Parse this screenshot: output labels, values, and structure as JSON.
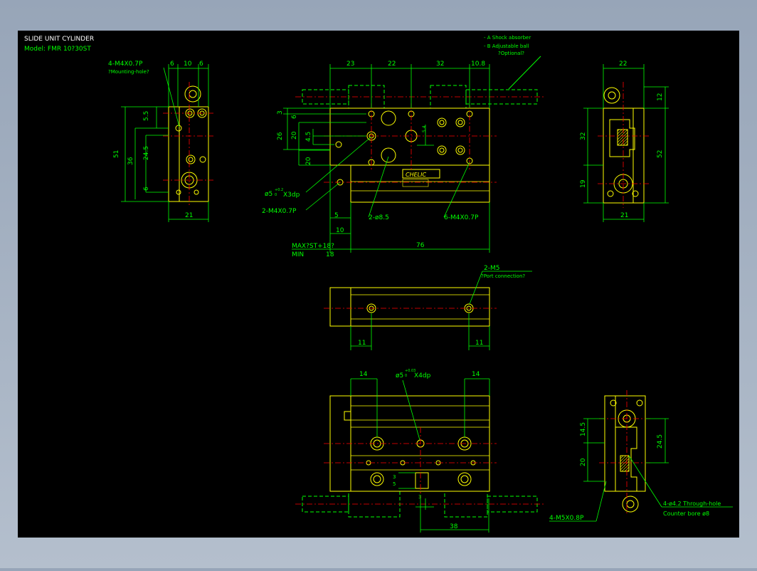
{
  "title_block": {
    "title": "SLIDE UNIT CYLINDER",
    "model": "Model: FMR 10?30ST"
  },
  "legend": {
    "item_a": "- A  Shock absorber",
    "item_b": "- B  Adjustable ball",
    "item_b_note": "?Optional?"
  },
  "colors": {
    "background": "#000000",
    "outline": "#ffff00",
    "dimension": "#00ff00",
    "centerline": "#ff0000",
    "hidden": "#00ff00"
  },
  "left_view": {
    "callout": "4-M4X0.7P",
    "callout_note": "?Mounting-hole?",
    "dim_top": [
      "6",
      "10",
      "6"
    ],
    "dim_left": [
      "5.5",
      "51",
      "36",
      "24.5",
      "6"
    ],
    "dim_bottom": "21"
  },
  "front_view": {
    "dim_top": [
      "23",
      "22",
      "32",
      "10.8"
    ],
    "dim_left": [
      "3",
      "6",
      "26",
      "20",
      "4.5",
      "20"
    ],
    "dim_inner": "5.4",
    "hole_callout": "ø5",
    "hole_tol": "+0.2",
    "hole_tol2": "0",
    "hole_depth": "X3dp",
    "callout_m4": "2-M4X0.7P",
    "callout_d85": "2-ø8.5",
    "callout_6m4": "6-M4X0.7P",
    "dim_5": "5",
    "dim_10": "10",
    "max_label": "MAX?ST+18?",
    "min_label": "MIN",
    "min_value": "18",
    "dim_76": "76",
    "badge": "CHELIC"
  },
  "right_view": {
    "dim_top": "22",
    "dim_12": "12",
    "dim_32": "32",
    "dim_52": "52",
    "dim_19": "19",
    "dim_bottom": "21"
  },
  "middle_view": {
    "port_callout": "2-M5",
    "port_note": "?Port connection?",
    "dim_left": "11",
    "dim_right": "11"
  },
  "bottom_view": {
    "dim_14_left": "14",
    "dim_14_right": "14",
    "hole_callout": "ø5",
    "hole_tol": "+0.03",
    "hole_tol2": "0",
    "hole_depth": "X4dp",
    "dim_3a": "3",
    "dim_5": "5",
    "dim_3b": "3",
    "dim_38": "38"
  },
  "bottom_right_view": {
    "dim_14_5": "14.5",
    "dim_20": "20",
    "dim_24_5": "24.5",
    "callout_m5": "4-M5X0.8P",
    "callout_through": "4-ø4.2  Through-hole",
    "callout_counter": "Counter bore  ø8"
  }
}
